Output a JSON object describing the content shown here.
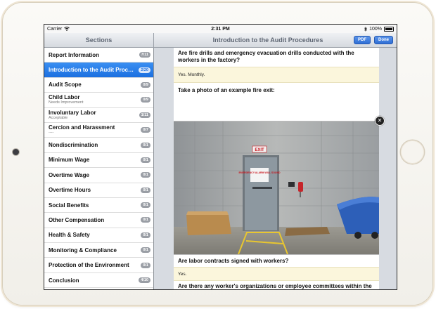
{
  "status": {
    "carrier": "Carrier",
    "time": "2:31 PM",
    "battery": "100%"
  },
  "sidebar": {
    "title": "Sections",
    "items": [
      {
        "label": "Report Information",
        "sub": "",
        "badge": "7/11"
      },
      {
        "label": "Introduction to the Audit Procedures",
        "sub": "",
        "badge": "2/20"
      },
      {
        "label": "Audit Scope",
        "sub": "",
        "badge": "0/9"
      },
      {
        "label": "Child Labor",
        "sub": "Needs Improvement",
        "badge": "0/9"
      },
      {
        "label": "Involuntary Labor",
        "sub": "Acceptable",
        "badge": "1/11"
      },
      {
        "label": "Cercion and Harassment",
        "sub": "----",
        "badge": "0/7"
      },
      {
        "label": "Nondiscrimination",
        "sub": "",
        "badge": "0/1"
      },
      {
        "label": "Minimum Wage",
        "sub": "",
        "badge": "0/1"
      },
      {
        "label": "Overtime Wage",
        "sub": "",
        "badge": "0/1"
      },
      {
        "label": "Overtime Hours",
        "sub": "",
        "badge": "0/1"
      },
      {
        "label": "Social Benefits",
        "sub": "",
        "badge": "0/1"
      },
      {
        "label": "Other Compensation",
        "sub": "",
        "badge": "0/1"
      },
      {
        "label": "Health & Safety",
        "sub": "",
        "badge": "0/1"
      },
      {
        "label": "Monitoring & Compliance",
        "sub": "",
        "badge": "0/1"
      },
      {
        "label": "Protection of the Environment",
        "sub": "",
        "badge": "0/1"
      },
      {
        "label": "Conclusion",
        "sub": "",
        "badge": "4/10"
      }
    ]
  },
  "header": {
    "title": "Introduction to the Audit Procedures",
    "pdf_label": "PDF",
    "done_label": "Done"
  },
  "content": {
    "q1": "Are fire drills and emergency evacuation drills conducted with the workers in the factory?",
    "a1": "Yes. Monthly.",
    "q2": "Take a photo of an example fire exit:",
    "photo": {
      "exit_sign": "EXIT",
      "door_sign": "EMERGENCY ALARM WILL SOUND"
    },
    "q3": "Are labor contracts signed with workers?",
    "a3": "Yes.",
    "q4": "Are there any worker's organizations or employee committees within the factory?"
  },
  "colors": {
    "accent": "#1b6fe0",
    "answer_bg": "#fbf6dc",
    "navbar": "#d5d9df"
  }
}
